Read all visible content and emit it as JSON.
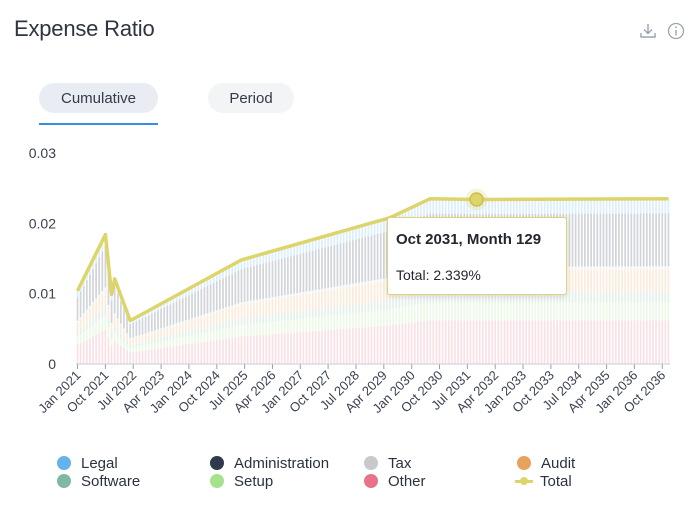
{
  "header": {
    "title": "Expense Ratio"
  },
  "icons": {
    "download": "download-icon",
    "info": "info-icon"
  },
  "tabs": [
    {
      "label": "Cumulative",
      "active": true
    },
    {
      "label": "Period",
      "active": false
    }
  ],
  "tooltip": {
    "title": "Oct 2031, Month 129",
    "value": "Total: 2.339%"
  },
  "colors": {
    "Legal": "#63b3ec",
    "Administration": "#2f3a4d",
    "Tax": "#c7c9cc",
    "Audit": "#e8a25c",
    "Software": "#7fb9a1",
    "Setup": "#a4e38c",
    "Other": "#e8728a",
    "Total": "#ddd56b"
  },
  "chart_data": {
    "type": "area",
    "title": "Expense Ratio",
    "xlabel": "",
    "ylabel": "",
    "ylim": [
      0,
      0.03
    ],
    "yticks": [
      "0",
      "0.01",
      "0.02",
      "0.03"
    ],
    "xticks": [
      "Jan 2021",
      "Oct 2021",
      "Jul 2022",
      "Apr 2023",
      "Jan 2024",
      "Oct 2024",
      "Jul 2025",
      "Apr 2026",
      "Jan 2027",
      "Oct 2027",
      "Jul 2028",
      "Apr 2029",
      "Jan 2030",
      "Oct 2030",
      "Jul 2031",
      "Apr 2032",
      "Jan 2033",
      "Oct 2033",
      "Jul 2034",
      "Apr 2035",
      "Jan 2036",
      "Oct 2036"
    ],
    "grid": false,
    "legend_position": "bottom",
    "legend": [
      "Legal",
      "Administration",
      "Tax",
      "Audit",
      "Software",
      "Setup",
      "Other",
      "Total"
    ],
    "total_series": {
      "name": "Total",
      "x": [
        "Jan 2021",
        "Oct 2021",
        "Dec 2021",
        "Jan 2022",
        "Jun 2022",
        "Jul 2022",
        "Jun 2025",
        "Jun 2029",
        "Jul 2030",
        "Oct 2031",
        "Dec 2036"
      ],
      "values": [
        0.0104,
        0.0184,
        0.0099,
        0.0121,
        0.0062,
        0.0064,
        0.0148,
        0.0208,
        0.0235,
        0.02339,
        0.0235
      ]
    },
    "stack_series_after_jul_2030": [
      {
        "name": "Other",
        "value": 0.0062
      },
      {
        "name": "Setup",
        "value": 0.0026
      },
      {
        "name": "Software",
        "value": 0.0015
      },
      {
        "name": "Audit",
        "value": 0.0031
      },
      {
        "name": "Tax",
        "value": 0.0005
      },
      {
        "name": "Administration",
        "value": 0.0075
      },
      {
        "name": "Legal",
        "value": 0.0021
      }
    ],
    "highlight": {
      "x": "Oct 2031",
      "month": 129,
      "value": 0.02339
    }
  }
}
